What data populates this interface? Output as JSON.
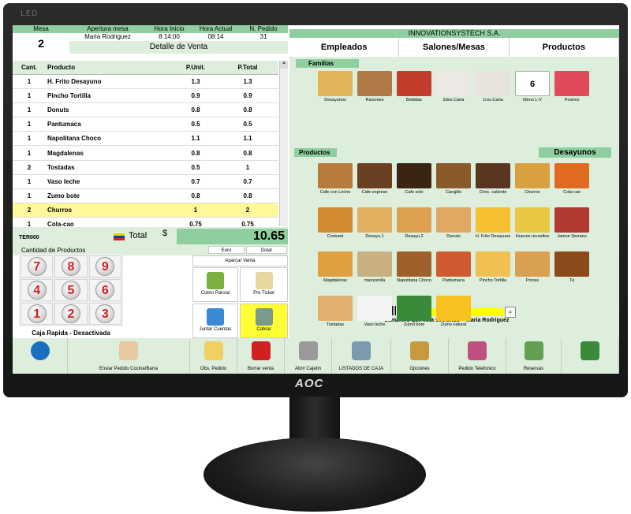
{
  "monitor": {
    "led_label": "LED",
    "brand": "AOC"
  },
  "header": {
    "mesa_label": "Mesa",
    "mesa_value": "2",
    "apertura_label": "Apertura mesa",
    "apertura_value": "Maria Rodriguez",
    "hora_inicio_label": "Hora Inicio",
    "hora_inicio_value": "8:14:00",
    "hora_actual_label": "Hora Actual",
    "hora_actual_value": "08:14",
    "pedido_label": "N. Pedido",
    "pedido_value": "31",
    "detalle_title": "Detalle de Venta"
  },
  "table": {
    "columns": [
      "Cant.",
      "Producto",
      "P.Unit.",
      "P.Total"
    ],
    "rows": [
      {
        "cant": "1",
        "producto": "H. Frito Desayuno",
        "unit": "1.3",
        "total": "1.3"
      },
      {
        "cant": "1",
        "producto": "Pincho Tortilla",
        "unit": "0.9",
        "total": "0.9"
      },
      {
        "cant": "1",
        "producto": "Donuts",
        "unit": "0.8",
        "total": "0.8"
      },
      {
        "cant": "1",
        "producto": "Pantumaca",
        "unit": "0.5",
        "total": "0.5"
      },
      {
        "cant": "1",
        "producto": "Napolitana Choco",
        "unit": "1.1",
        "total": "1.1"
      },
      {
        "cant": "1",
        "producto": "Magdalenas",
        "unit": "0.8",
        "total": "0.8"
      },
      {
        "cant": "2",
        "producto": "Tostadas",
        "unit": "0.5",
        "total": "1"
      },
      {
        "cant": "1",
        "producto": "Vaso leche",
        "unit": "0.7",
        "total": "0.7"
      },
      {
        "cant": "1",
        "producto": "Zumo bote",
        "unit": "0.8",
        "total": "0.8"
      },
      {
        "cant": "2",
        "producto": "Churros",
        "unit": "1",
        "total": "2"
      },
      {
        "cant": "1",
        "producto": "Cola-cao",
        "unit": "0.75",
        "total": "0.75"
      }
    ],
    "selected_index": 9
  },
  "totals": {
    "terminal": "TER000",
    "total_label": "Total",
    "currency_symbol": "$",
    "total_value": "10.65",
    "euro_label": "Euro",
    "dolar_label": "Dolar"
  },
  "keypad": {
    "title": "Cantidad de Productos",
    "keys": [
      "7",
      "8",
      "9",
      "4",
      "5",
      "6",
      "1",
      "2",
      "3"
    ],
    "caja_rapida": "Caja Rapida - Desactivada"
  },
  "actions": {
    "aparcar": "Aparcar Venta",
    "cobro_parcial": "Cobro Parcial",
    "pre_ticket": "Pre Ticket",
    "juntar_cuentas": "Juntar Cuentas",
    "cobrar": "Cobrar"
  },
  "right": {
    "company": "INNOVATIONSYSTECH S.A.",
    "tabs": [
      "Empleados",
      "Salones/Mesas",
      "Productos"
    ],
    "familias_label": "Familias",
    "familias": [
      {
        "label": "Desayunos",
        "color": "#e2b45a"
      },
      {
        "label": "Raciones",
        "color": "#b07a48"
      },
      {
        "label": "Bebidas",
        "color": "#c43c2c"
      },
      {
        "label": "2dos.Carta",
        "color": "#ece9e4"
      },
      {
        "label": "1ros.Carta",
        "color": "#e8e4dc"
      },
      {
        "label": "Menu L-V",
        "color": "#ffffff",
        "number": "6"
      },
      {
        "label": "Postres",
        "color": "#e04a5a"
      }
    ],
    "productos_label": "Productos",
    "category_title": "Desayunos",
    "productos": [
      {
        "label": "Cafe con Leche",
        "color": "#b87b3c"
      },
      {
        "label": "Cafe expreso",
        "color": "#6b3f21"
      },
      {
        "label": "Cafe solo",
        "color": "#3a2414"
      },
      {
        "label": "Carajillo",
        "color": "#8a5a2a"
      },
      {
        "label": "Choc. caliente",
        "color": "#5a3520"
      },
      {
        "label": "Churros",
        "color": "#d9a040"
      },
      {
        "label": "Cola-cao",
        "color": "#e06a20"
      },
      {
        "label": "Croisant",
        "color": "#d08a30"
      },
      {
        "label": "Desayu.1",
        "color": "#e0b060"
      },
      {
        "label": "Desayu.2",
        "color": "#dca050"
      },
      {
        "label": "Donuts",
        "color": "#e0a860"
      },
      {
        "label": "H. Frito Desayuno",
        "color": "#f5c030"
      },
      {
        "label": "Huevos revueltos",
        "color": "#e8c840"
      },
      {
        "label": "Jamon Serrano",
        "color": "#b03a30"
      },
      {
        "label": "Magdalenas",
        "color": "#e0a040"
      },
      {
        "label": "manzanilla",
        "color": "#c8b080"
      },
      {
        "label": "Napolitana Choco",
        "color": "#a0602a"
      },
      {
        "label": "Pantumaca",
        "color": "#d05a30"
      },
      {
        "label": "Pincho Tortilla",
        "color": "#f0c050"
      },
      {
        "label": "Porras",
        "color": "#d8a050"
      },
      {
        "label": "Té",
        "color": "#8a4a1a"
      },
      {
        "label": "Tostadas",
        "color": "#e0b070"
      },
      {
        "label": "Vaso leche",
        "color": "#f4f4f4"
      },
      {
        "label": "Zumo bote",
        "color": "#3a8a3a"
      },
      {
        "label": "Zumo natural",
        "color": "#f8c020"
      }
    ],
    "camarero": "Camarero que esta sirviendo = Maria Rodriguez",
    "search_icon": "magnifier-icon"
  },
  "toolbar": {
    "items": [
      {
        "label": "",
        "icon": "info-icon",
        "color": "#1a6ec0"
      },
      {
        "label": "Enviar Pedido Cocina/Barra",
        "icon": "chef-icon",
        "color": "#e8c8a0"
      },
      {
        "label": "Obs. Pedido",
        "icon": "notepad-icon",
        "color": "#f0d060"
      },
      {
        "label": "Borrar venta",
        "icon": "trash-icon",
        "color": "#d02020"
      },
      {
        "label": "Abrir Cajetin",
        "icon": "safe-icon",
        "color": "#9a9a9a"
      },
      {
        "label": "LISTADOS DE CAJA",
        "icon": "printer-icon",
        "color": "#7a9ab0"
      },
      {
        "label": "Opciones",
        "icon": "tools-icon",
        "color": "#c89a40"
      },
      {
        "label": "Pedido Telefonico",
        "icon": "phone-user-icon",
        "color": "#c05080"
      },
      {
        "label": "Reservas",
        "icon": "calendar-icon",
        "color": "#60a050"
      },
      {
        "label": "",
        "icon": "exit-icon",
        "color": "#3a8a3a"
      }
    ]
  }
}
